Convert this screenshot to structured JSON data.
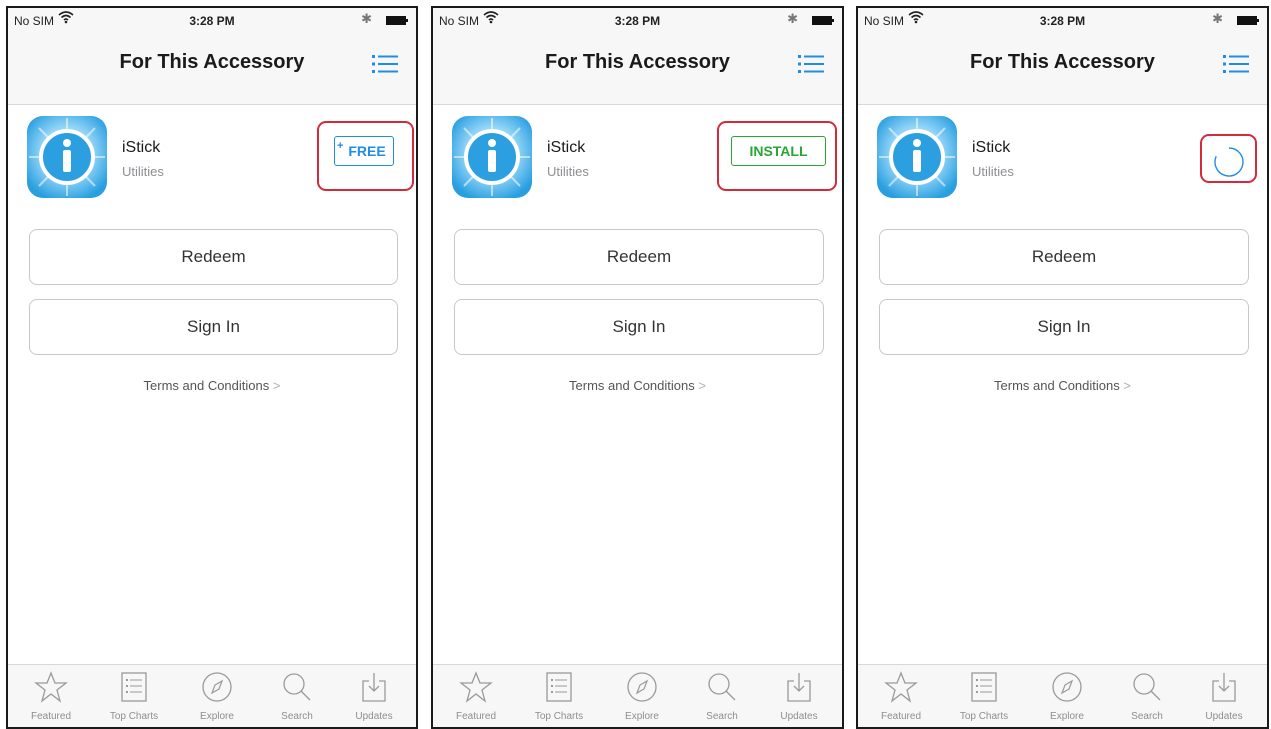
{
  "status_bar": {
    "carrier": "No SIM",
    "time": "3:28 PM",
    "bluetooth_glyph": "✱"
  },
  "nav": {
    "title": "For This Accessory",
    "list_icon": "list-icon"
  },
  "app": {
    "name": "iStick",
    "category": "Utilities"
  },
  "screens": [
    {
      "action_state": "free",
      "action_label": "FREE"
    },
    {
      "action_state": "install",
      "action_label": "INSTALL"
    },
    {
      "action_state": "downloading"
    }
  ],
  "buttons": {
    "redeem": "Redeem",
    "sign_in": "Sign In"
  },
  "terms": {
    "label": "Terms and Conditions",
    "chevron": ">"
  },
  "tabs": [
    {
      "label": "Featured",
      "icon": "star-icon"
    },
    {
      "label": "Top Charts",
      "icon": "top-charts-icon"
    },
    {
      "label": "Explore",
      "icon": "compass-icon"
    },
    {
      "label": "Search",
      "icon": "search-icon"
    },
    {
      "label": "Updates",
      "icon": "updates-icon"
    }
  ],
  "colors": {
    "highlight": "#d42b3c",
    "free_blue": "#1f8ce8",
    "install_green": "#27a633",
    "tab_gray": "#9a9a9a"
  }
}
